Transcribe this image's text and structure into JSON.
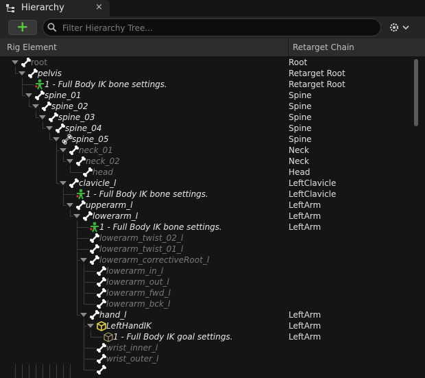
{
  "tab": {
    "title": "Hierarchy",
    "close": "×"
  },
  "toolbar": {
    "add": "+",
    "search_placeholder": "Filter Hierarchy Tree..."
  },
  "columns": {
    "element": "Rig Element",
    "chain": "Retarget Chain"
  },
  "rows": [
    {
      "label": "root",
      "chain": "Root",
      "depth": 0,
      "icon": "bone-icon",
      "arrow": true,
      "style": "dim-plain"
    },
    {
      "label": "pelvis",
      "chain": "Retarget Root",
      "depth": 1,
      "icon": "bone-icon",
      "arrow": true,
      "style": "normal"
    },
    {
      "label": "1 - Full Body IK bone settings.",
      "chain": "Retarget Root",
      "depth": 2,
      "icon": "ik-person-icon",
      "arrow": false,
      "style": "normal"
    },
    {
      "label": "spine_01",
      "chain": "Spine",
      "depth": 2,
      "icon": "bone-icon",
      "arrow": true,
      "style": "normal"
    },
    {
      "label": "spine_02",
      "chain": "Spine",
      "depth": 3,
      "icon": "bone-icon",
      "arrow": true,
      "style": "normal"
    },
    {
      "label": "spine_03",
      "chain": "Spine",
      "depth": 4,
      "icon": "bone-icon",
      "arrow": true,
      "style": "normal"
    },
    {
      "label": "spine_04",
      "chain": "Spine",
      "depth": 5,
      "icon": "bone-icon",
      "arrow": true,
      "style": "normal"
    },
    {
      "label": "spine_05",
      "chain": "Spine",
      "depth": 6,
      "icon": "bone-outline-icon",
      "arrow": true,
      "style": "normal"
    },
    {
      "label": "neck_01",
      "chain": "Neck",
      "depth": 7,
      "icon": "bone-icon",
      "arrow": true,
      "style": "dim"
    },
    {
      "label": "neck_02",
      "chain": "Neck",
      "depth": 8,
      "icon": "bone-icon",
      "arrow": true,
      "style": "dim"
    },
    {
      "label": "head",
      "chain": "Head",
      "depth": 9,
      "icon": "bone-icon",
      "arrow": false,
      "style": "dim"
    },
    {
      "label": "clavicle_l",
      "chain": "LeftClavicle",
      "depth": 7,
      "icon": "bone-icon",
      "arrow": true,
      "style": "normal"
    },
    {
      "label": "1 - Full Body IK bone settings.",
      "chain": "LeftClavicle",
      "depth": 8,
      "icon": "ik-person-icon",
      "arrow": false,
      "style": "normal"
    },
    {
      "label": "upperarm_l",
      "chain": "LeftArm",
      "depth": 8,
      "icon": "bone-icon",
      "arrow": true,
      "style": "normal"
    },
    {
      "label": "lowerarm_l",
      "chain": "LeftArm",
      "depth": 9,
      "icon": "bone-icon",
      "arrow": true,
      "style": "normal"
    },
    {
      "label": "1 - Full Body IK bone settings.",
      "chain": "LeftArm",
      "depth": 10,
      "icon": "ik-person-icon",
      "arrow": false,
      "style": "normal"
    },
    {
      "label": "lowerarm_twist_02_l",
      "chain": "",
      "depth": 10,
      "icon": "bone-icon",
      "arrow": false,
      "style": "dim"
    },
    {
      "label": "lowerarm_twist_01_l",
      "chain": "",
      "depth": 10,
      "icon": "bone-icon",
      "arrow": false,
      "style": "dim"
    },
    {
      "label": "lowerarm_correctiveRoot_l",
      "chain": "",
      "depth": 10,
      "icon": "bone-icon",
      "arrow": true,
      "style": "dim"
    },
    {
      "label": "lowerarm_in_l",
      "chain": "",
      "depth": 11,
      "icon": "bone-icon",
      "arrow": false,
      "style": "dim"
    },
    {
      "label": "lowerarm_out_l",
      "chain": "",
      "depth": 11,
      "icon": "bone-icon",
      "arrow": false,
      "style": "dim"
    },
    {
      "label": "lowerarm_fwd_l",
      "chain": "",
      "depth": 11,
      "icon": "bone-icon",
      "arrow": false,
      "style": "dim"
    },
    {
      "label": "lowerarm_bck_l",
      "chain": "",
      "depth": 11,
      "icon": "bone-icon",
      "arrow": false,
      "style": "dim"
    },
    {
      "label": "hand_l",
      "chain": "LeftArm",
      "depth": 10,
      "icon": "bone-icon",
      "arrow": true,
      "style": "normal"
    },
    {
      "label": "LeftHandIK",
      "chain": "LeftArm",
      "depth": 11,
      "icon": "goal-box-icon",
      "arrow": true,
      "style": "normal"
    },
    {
      "label": "1 - Full Body IK goal settings.",
      "chain": "LeftArm",
      "depth": 12,
      "icon": "goal-settings-icon",
      "arrow": false,
      "style": "normal"
    },
    {
      "label": "wrist_inner_l",
      "chain": "",
      "depth": 11,
      "icon": "bone-icon",
      "arrow": false,
      "style": "dim"
    },
    {
      "label": "wrist_outer_l",
      "chain": "",
      "depth": 11,
      "icon": "bone-icon",
      "arrow": false,
      "style": "dim"
    },
    {
      "label": "",
      "chain": "",
      "depth": 11,
      "icon": "bone-icon",
      "arrow": false,
      "style": "dim"
    }
  ],
  "colors": {
    "accent_green": "#59c83a",
    "goal_yellow": "#e6d23a",
    "ik_green": "#3cb43c"
  }
}
